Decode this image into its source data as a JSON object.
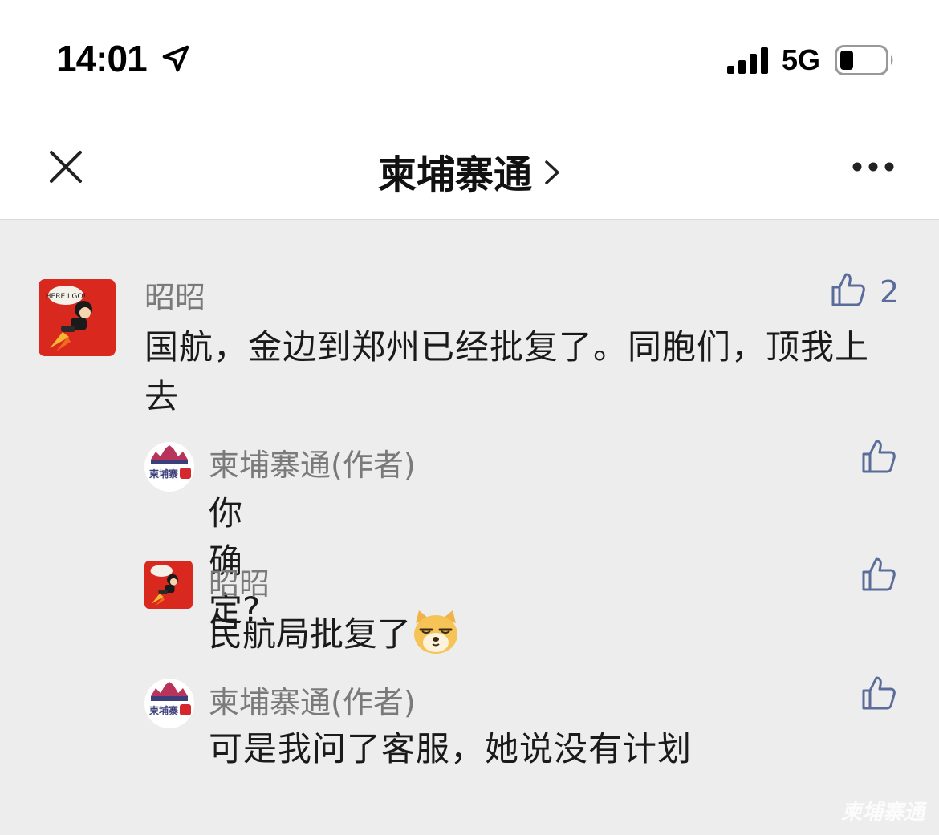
{
  "status_bar": {
    "time": "14:01",
    "network": "5G"
  },
  "nav": {
    "title": "柬埔寨通"
  },
  "comments": [
    {
      "name": "昭昭",
      "text": "国航，金边到郑州已经批复了。同胞们，顶我上去",
      "likes": "2"
    },
    {
      "name": "柬埔寨通(作者)",
      "text": "你确定?"
    },
    {
      "name": "昭昭",
      "text": "民航局批复了"
    },
    {
      "name": "柬埔寨通(作者)",
      "text": "可是我问了客服，她说没有计划"
    }
  ],
  "avatar_badges": {
    "astro": "HERE I GO!",
    "brand": "柬埔寨"
  },
  "watermark": "柬埔寨通",
  "colors": {
    "like_blue": "#5a6d9a",
    "avatar_red": "#d9281e",
    "background": "#ededed"
  }
}
